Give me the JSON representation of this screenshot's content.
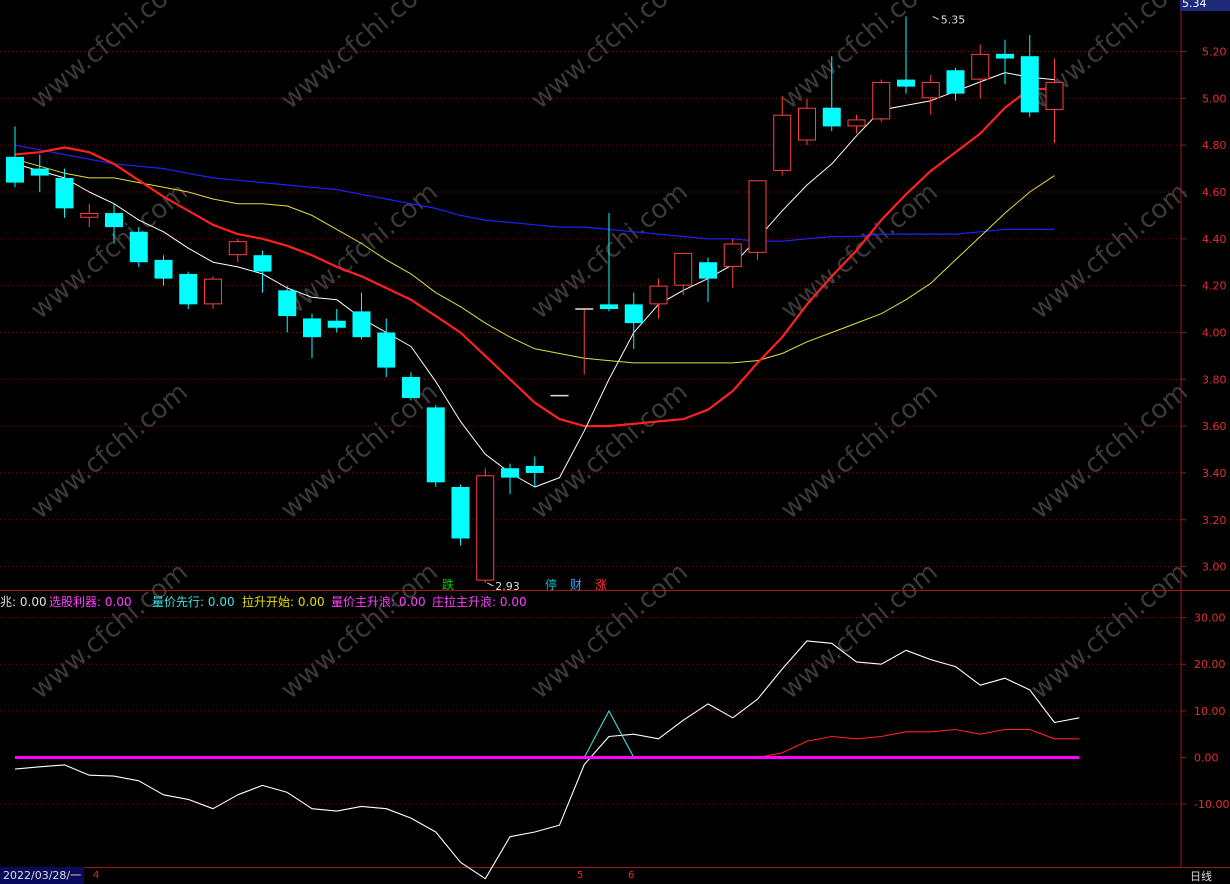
{
  "last_price_label": "5.34",
  "date_label": "2022/03/28/一",
  "period_label": "日线",
  "bottom_numbers": [
    "4",
    "5",
    "6"
  ],
  "event_markers": [
    {
      "text": "跌",
      "color": "#00d000"
    },
    {
      "text": "停",
      "color": "#00c0c0"
    },
    {
      "text": "财",
      "color": "#40a0ff"
    },
    {
      "text": "涨",
      "color": "#ff3030"
    }
  ],
  "indicator_labels": [
    {
      "name": "兆:",
      "value": "0.00",
      "name_color": "#e0e0e0",
      "value_color": "#e0e0e0"
    },
    {
      "name": "选股利器:",
      "value": "0.00",
      "name_color": "#ff40ff",
      "value_color": "#ff40ff"
    },
    {
      "name": "量价先行:",
      "value": "0.00",
      "name_color": "#40e0e0",
      "value_color": "#40e0e0"
    },
    {
      "name": "拉升开始:",
      "value": "0.00",
      "name_color": "#e0e000",
      "value_color": "#e0e000"
    },
    {
      "name": "量价主升浪:",
      "value": "0.00",
      "name_color": "#ff40ff",
      "value_color": "#ff40ff"
    },
    {
      "name": "庄拉主升浪:",
      "value": "0.00",
      "name_color": "#ff40ff",
      "value_color": "#ff40ff"
    }
  ],
  "watermark": "www.cfchi.com",
  "chart_data": [
    {
      "type": "candlestick",
      "ylim": [
        2.9,
        5.42
      ],
      "yticks": [
        3.0,
        3.2,
        3.4,
        3.6,
        3.8,
        4.0,
        4.2,
        4.4,
        4.6,
        4.8,
        5.0,
        5.2
      ],
      "ytick_labels": [
        "3.00",
        "3.20",
        "3.40",
        "3.60",
        "3.80",
        "4.00",
        "4.20",
        "4.40",
        "4.60",
        "4.80",
        "5.00",
        "5.20"
      ],
      "annotations": [
        {
          "text": "5.35",
          "index": 37,
          "price": 5.35
        },
        {
          "text": "2.93",
          "index": 19,
          "price": 2.93
        }
      ],
      "colors": {
        "up": "#ff4040",
        "down": "#00ffff",
        "ma5": "#ffffff",
        "ma10": "#ff2020",
        "ma20": "#e0e040",
        "ma60": "#2020ff"
      },
      "candles": [
        {
          "o": 4.75,
          "h": 4.88,
          "l": 4.62,
          "c": 4.64
        },
        {
          "o": 4.7,
          "h": 4.76,
          "l": 4.6,
          "c": 4.67
        },
        {
          "o": 4.66,
          "h": 4.7,
          "l": 4.49,
          "c": 4.53
        },
        {
          "o": 4.49,
          "h": 4.55,
          "l": 4.45,
          "c": 4.51
        },
        {
          "o": 4.51,
          "h": 4.55,
          "l": 4.38,
          "c": 4.45
        },
        {
          "o": 4.43,
          "h": 4.45,
          "l": 4.28,
          "c": 4.3
        },
        {
          "o": 4.31,
          "h": 4.33,
          "l": 4.2,
          "c": 4.23
        },
        {
          "o": 4.25,
          "h": 4.26,
          "l": 4.1,
          "c": 4.12
        },
        {
          "o": 4.12,
          "h": 4.24,
          "l": 4.1,
          "c": 4.23
        },
        {
          "o": 4.33,
          "h": 4.4,
          "l": 4.3,
          "c": 4.39
        },
        {
          "o": 4.33,
          "h": 4.35,
          "l": 4.17,
          "c": 4.26
        },
        {
          "o": 4.18,
          "h": 4.2,
          "l": 4.0,
          "c": 4.07
        },
        {
          "o": 4.06,
          "h": 4.08,
          "l": 3.89,
          "c": 3.98
        },
        {
          "o": 4.05,
          "h": 4.1,
          "l": 4.0,
          "c": 4.02
        },
        {
          "o": 4.09,
          "h": 4.17,
          "l": 3.97,
          "c": 3.98
        },
        {
          "o": 4.0,
          "h": 4.06,
          "l": 3.81,
          "c": 3.85
        },
        {
          "o": 3.81,
          "h": 3.83,
          "l": 3.71,
          "c": 3.72
        },
        {
          "o": 3.68,
          "h": 3.69,
          "l": 3.34,
          "c": 3.36
        },
        {
          "o": 3.34,
          "h": 3.35,
          "l": 3.09,
          "c": 3.12
        },
        {
          "o": 2.94,
          "h": 3.42,
          "l": 2.93,
          "c": 3.39
        },
        {
          "o": 3.42,
          "h": 3.44,
          "l": 3.31,
          "c": 3.38
        },
        {
          "o": 3.43,
          "h": 3.47,
          "l": 3.34,
          "c": 3.4
        },
        {
          "o": 3.73,
          "h": 3.73,
          "l": 3.73,
          "c": 3.73
        },
        {
          "o": 4.1,
          "h": 4.1,
          "l": 3.82,
          "c": 4.1
        },
        {
          "o": 4.12,
          "h": 4.51,
          "l": 4.09,
          "c": 4.1
        },
        {
          "o": 4.12,
          "h": 4.17,
          "l": 3.93,
          "c": 4.04
        },
        {
          "o": 4.12,
          "h": 4.23,
          "l": 4.06,
          "c": 4.2
        },
        {
          "o": 4.2,
          "h": 4.33,
          "l": 4.16,
          "c": 4.34
        },
        {
          "o": 4.3,
          "h": 4.32,
          "l": 4.13,
          "c": 4.23
        },
        {
          "o": 4.28,
          "h": 4.4,
          "l": 4.19,
          "c": 4.38
        },
        {
          "o": 4.34,
          "h": 4.52,
          "l": 4.31,
          "c": 4.65
        },
        {
          "o": 4.69,
          "h": 5.01,
          "l": 4.67,
          "c": 4.93
        },
        {
          "o": 4.82,
          "h": 5.0,
          "l": 4.8,
          "c": 4.96
        },
        {
          "o": 4.96,
          "h": 5.18,
          "l": 4.86,
          "c": 4.88
        },
        {
          "o": 4.88,
          "h": 4.93,
          "l": 4.85,
          "c": 4.91
        },
        {
          "o": 4.91,
          "h": 5.08,
          "l": 4.9,
          "c": 5.07
        },
        {
          "o": 5.08,
          "h": 5.35,
          "l": 5.02,
          "c": 5.05
        },
        {
          "o": 5.0,
          "h": 5.1,
          "l": 4.93,
          "c": 5.07
        },
        {
          "o": 5.12,
          "h": 5.13,
          "l": 4.99,
          "c": 5.02
        },
        {
          "o": 5.08,
          "h": 5.23,
          "l": 5.0,
          "c": 5.19
        },
        {
          "o": 5.19,
          "h": 5.25,
          "l": 5.06,
          "c": 5.17
        },
        {
          "o": 5.18,
          "h": 5.27,
          "l": 4.92,
          "c": 4.94
        },
        {
          "o": 4.95,
          "h": 5.17,
          "l": 4.81,
          "c": 5.07
        }
      ],
      "ma5": [
        4.72,
        4.69,
        4.66,
        4.6,
        4.55,
        4.48,
        4.43,
        4.36,
        4.3,
        4.28,
        4.25,
        4.19,
        4.15,
        4.14,
        4.06,
        4.0,
        3.94,
        3.79,
        3.62,
        3.48,
        3.4,
        3.34,
        3.38,
        3.58,
        3.8,
        4.0,
        4.12,
        4.18,
        4.23,
        4.29,
        4.4,
        4.52,
        4.63,
        4.72,
        4.84,
        4.95,
        4.97,
        4.99,
        5.03,
        5.07,
        5.11,
        5.09,
        5.08
      ],
      "ma10": [
        4.76,
        4.77,
        4.79,
        4.77,
        4.72,
        4.65,
        4.58,
        4.52,
        4.46,
        4.42,
        4.4,
        4.37,
        4.33,
        4.28,
        4.24,
        4.19,
        4.14,
        4.07,
        4.0,
        3.9,
        3.8,
        3.7,
        3.63,
        3.6,
        3.6,
        3.61,
        3.62,
        3.63,
        3.67,
        3.75,
        3.87,
        3.98,
        4.12,
        4.24,
        4.35,
        4.48,
        4.59,
        4.69,
        4.77,
        4.85,
        4.96,
        5.04,
        5.04
      ],
      "ma20": [
        4.74,
        4.71,
        4.68,
        4.66,
        4.66,
        4.64,
        4.62,
        4.6,
        4.57,
        4.55,
        4.55,
        4.54,
        4.5,
        4.44,
        4.38,
        4.31,
        4.25,
        4.17,
        4.11,
        4.04,
        3.98,
        3.93,
        3.91,
        3.89,
        3.88,
        3.87,
        3.87,
        3.87,
        3.87,
        3.87,
        3.88,
        3.91,
        3.96,
        4.0,
        4.04,
        4.08,
        4.14,
        4.21,
        4.31,
        4.41,
        4.51,
        4.6,
        4.67
      ],
      "ma60": [
        4.8,
        4.78,
        4.76,
        4.74,
        4.72,
        4.71,
        4.7,
        4.68,
        4.66,
        4.65,
        4.64,
        4.63,
        4.62,
        4.61,
        4.59,
        4.57,
        4.55,
        4.53,
        4.5,
        4.48,
        4.47,
        4.46,
        4.45,
        4.45,
        4.44,
        4.43,
        4.42,
        4.41,
        4.4,
        4.4,
        4.39,
        4.39,
        4.4,
        4.41,
        4.41,
        4.42,
        4.42,
        4.42,
        4.42,
        4.43,
        4.44,
        4.44,
        4.44
      ]
    },
    {
      "type": "line",
      "ylim": [
        -23.5,
        35.5
      ],
      "yticks": [
        -10,
        0,
        10,
        20,
        30
      ],
      "ytick_labels": [
        "-10.00",
        "0.00",
        "10.00",
        "20.00",
        "30.00"
      ],
      "series": [
        {
          "color": "#ffffff",
          "values": [
            -2.5,
            -2.0,
            -1.6,
            -3.8,
            -4.0,
            -5.0,
            -8.0,
            -9.0,
            -11.0,
            -8.0,
            -6.0,
            -7.5,
            -11.0,
            -11.5,
            -10.5,
            -11.0,
            -13.0,
            -16.0,
            -22.5,
            -26.0,
            -17.0,
            -16.0,
            -14.5,
            -1.5,
            4.5,
            5.0,
            4.0,
            8.0,
            11.5,
            8.5,
            12.5,
            19.0,
            25.0,
            24.5,
            20.5,
            20.0,
            23.0,
            21.0,
            19.5,
            15.5,
            17.0,
            14.5,
            7.5,
            8.5
          ]
        },
        {
          "color": "#ff2020",
          "values": [
            null,
            null,
            null,
            null,
            null,
            null,
            null,
            null,
            null,
            null,
            null,
            null,
            null,
            null,
            null,
            null,
            null,
            null,
            null,
            null,
            null,
            null,
            null,
            null,
            null,
            null,
            null,
            null,
            null,
            null,
            0.0,
            1.0,
            3.5,
            4.5,
            4.0,
            4.5,
            5.5,
            5.5,
            6.0,
            5.0,
            6.0,
            6.0,
            4.0,
            4.0
          ]
        },
        {
          "color": "#40e0e0",
          "values": [
            null,
            null,
            null,
            null,
            null,
            null,
            null,
            null,
            null,
            null,
            null,
            null,
            null,
            null,
            null,
            null,
            null,
            null,
            null,
            null,
            null,
            null,
            null,
            0.0,
            10.0,
            0.0,
            null,
            null,
            null,
            null,
            null,
            null,
            null,
            null,
            null,
            null,
            null,
            null,
            null,
            null,
            null,
            null,
            null,
            null
          ]
        },
        {
          "color": "#ff00ff",
          "values": [
            0,
            0,
            0,
            0,
            0,
            0,
            0,
            0,
            0,
            0,
            0,
            0,
            0,
            0,
            0,
            0,
            0,
            0,
            0,
            0,
            0,
            0,
            0,
            0,
            0,
            0,
            0,
            0,
            0,
            0,
            0,
            0,
            0,
            0,
            0,
            0,
            0,
            0,
            0,
            0,
            0,
            0,
            0,
            0
          ]
        }
      ]
    }
  ]
}
